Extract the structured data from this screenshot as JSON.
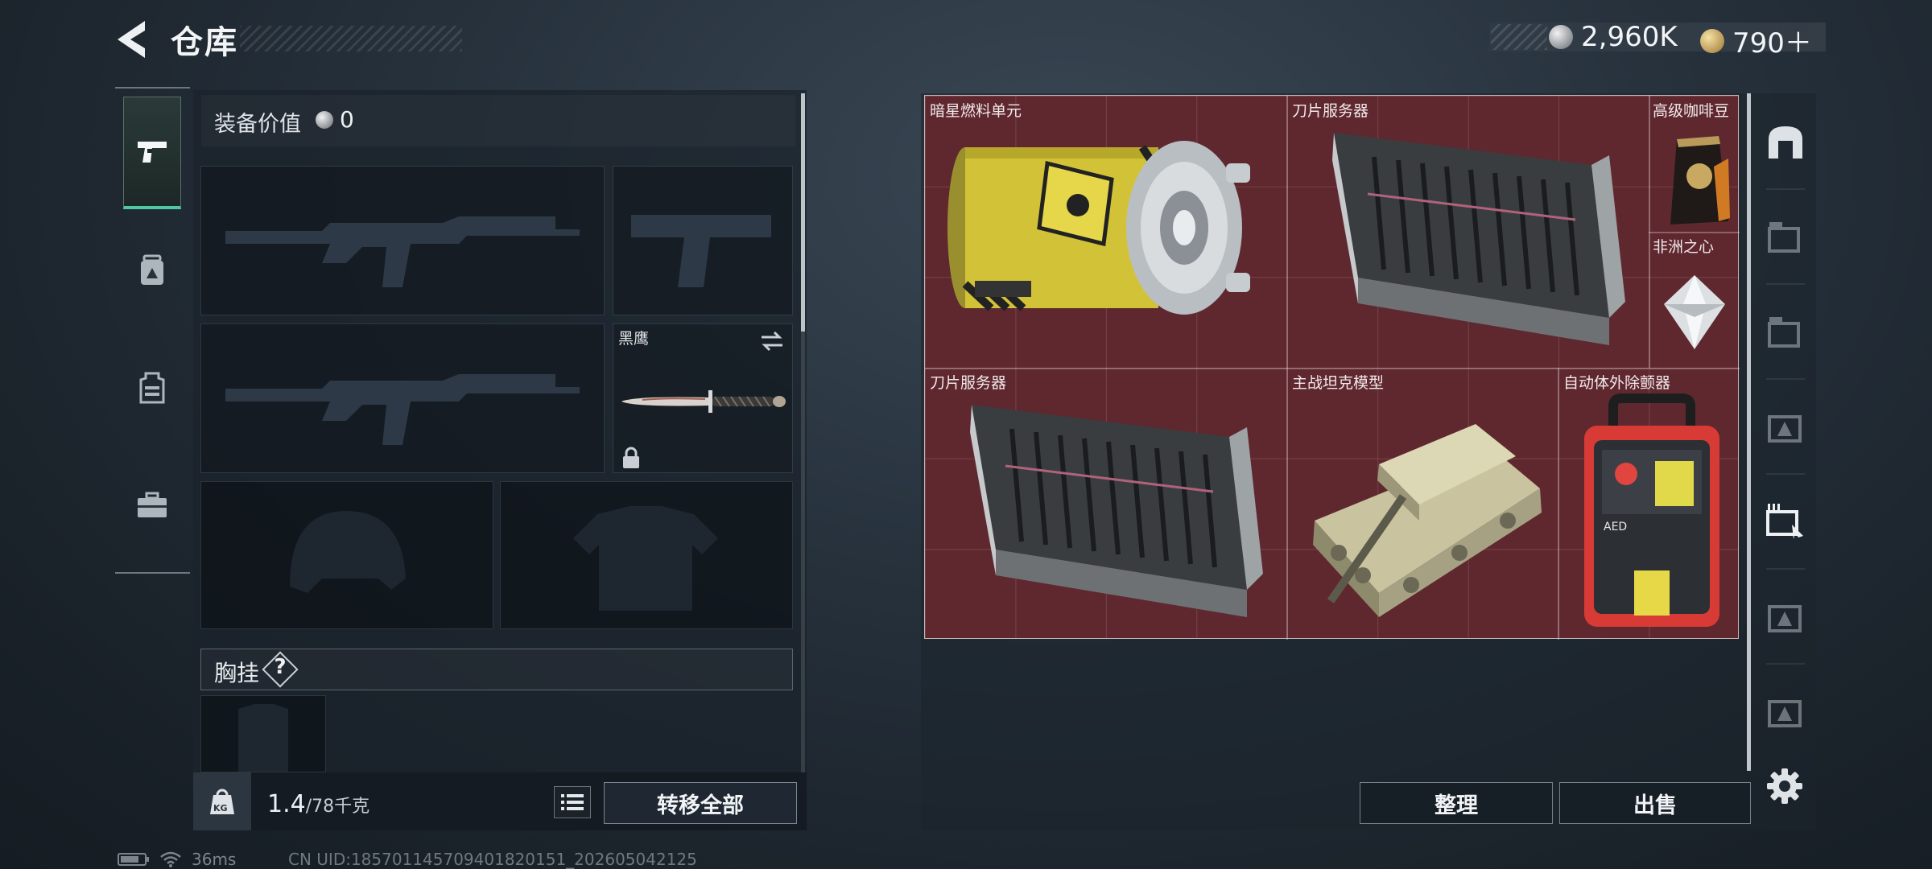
{
  "header": {
    "title": "仓库",
    "currencies": [
      {
        "icon": "silver-coin-icon",
        "value": "2,960K"
      },
      {
        "icon": "gold-coin-icon",
        "value": "790＋"
      }
    ]
  },
  "left_tabs": [
    {
      "icon": "pistol-icon",
      "active": true
    },
    {
      "icon": "backpack-icon",
      "active": false
    },
    {
      "icon": "vest-icon",
      "active": false
    },
    {
      "icon": "toolbox-icon",
      "active": false
    }
  ],
  "loadout": {
    "value_label": "装备价值",
    "value_amount": "0",
    "knife_name": "黑鹰",
    "chest_label": "胸挂",
    "chest_help": "?"
  },
  "bottom_left": {
    "kg_label": "KG",
    "weight_current": "1.4",
    "weight_max": "/78千克",
    "transfer_all": "转移全部"
  },
  "storage_items": [
    {
      "name": "暗星燃料单元",
      "icon": "fuel-canister-icon"
    },
    {
      "name": "刀片服务器",
      "icon": "blade-server-icon"
    },
    {
      "name": "高级咖啡豆",
      "icon": "coffee-bag-icon"
    },
    {
      "name": "非洲之心",
      "icon": "diamond-icon"
    },
    {
      "name": "刀片服务器",
      "icon": "blade-server-icon"
    },
    {
      "name": "主战坦克模型",
      "icon": "tank-model-icon"
    },
    {
      "name": "自动体外除颤器",
      "icon": "aed-icon"
    }
  ],
  "aed_text": "AED",
  "right_buttons": {
    "tidy": "整理",
    "sell": "出售"
  },
  "status_bar": {
    "ping": "36ms",
    "uid": "CN UID:18570114570940182015​1_202605042125"
  },
  "colors": {
    "accent": "#4fc6a4",
    "storage_bg": "#5f282f"
  }
}
